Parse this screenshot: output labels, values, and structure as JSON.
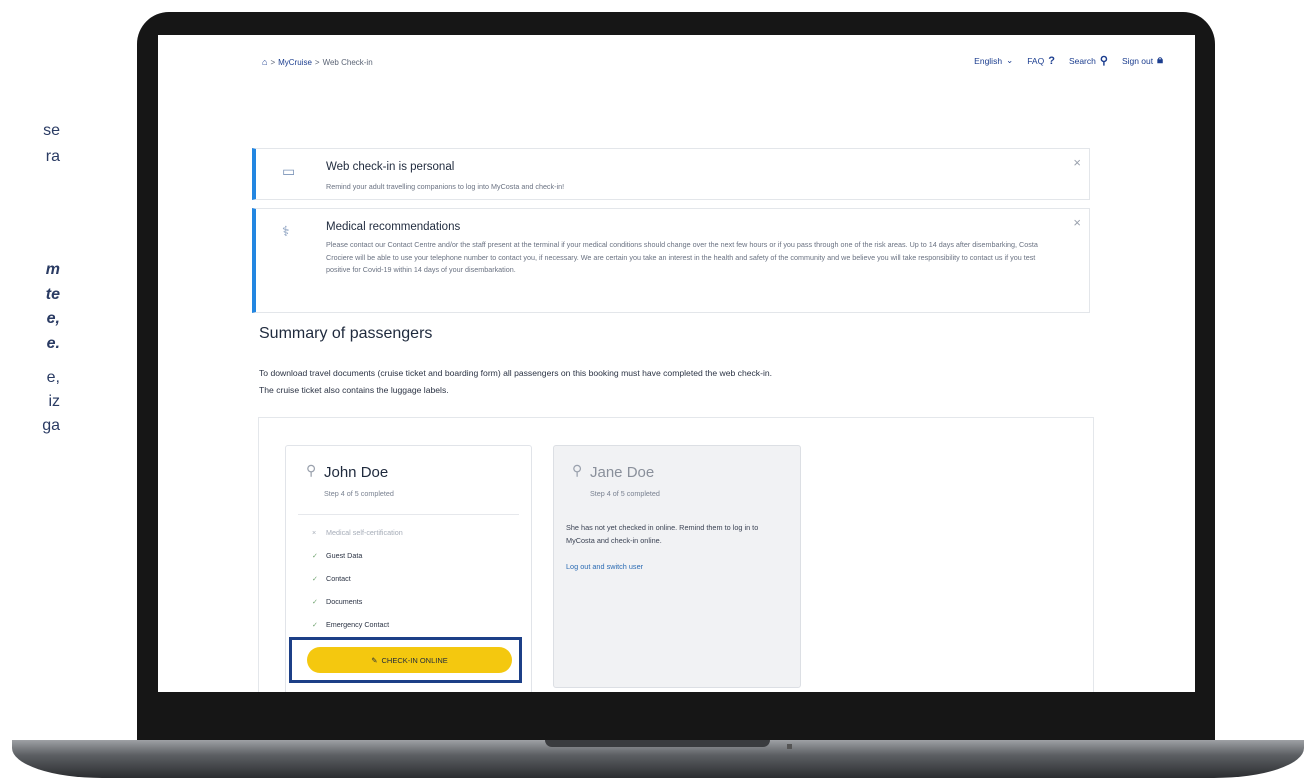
{
  "side_fragments": [
    {
      "text": "se",
      "style": "normal"
    },
    {
      "text": "ra",
      "style": "normal"
    },
    {
      "text": "m",
      "style": "bi"
    },
    {
      "text": "te",
      "style": "bi"
    },
    {
      "text": "e,",
      "style": "bi"
    },
    {
      "text": "e.",
      "style": "bi"
    },
    {
      "text": "e,",
      "style": "normal"
    },
    {
      "text": "iz",
      "style": "normal"
    },
    {
      "text": "ga",
      "style": "normal"
    }
  ],
  "breadcrumb": {
    "home_icon": "home-icon",
    "sep": ">",
    "mycruise": "MyCruise",
    "current": "Web Check-in"
  },
  "topnav": {
    "language": "English",
    "faq": "FAQ",
    "search": "Search",
    "signout": "Sign out"
  },
  "alerts": [
    {
      "title": "Web check-in is personal",
      "body": "Remind your adult travelling companions to log into MyCosta and check-in!"
    },
    {
      "title": "Medical recommendations",
      "body": "Please contact our Contact Centre and/or the staff present at the terminal if your medical conditions should change over the next few hours or if you pass through one of the risk areas. Up to 14 days after disembarking, Costa Crociere will be able to use your telephone number to contact you, if necessary. We are certain you take an interest in the health and safety of the community and we believe you will take responsibility to contact us if you test positive for Covid-19 within 14 days of your disembarkation."
    }
  ],
  "summary": {
    "title": "Summary of passengers",
    "line1": "To download travel documents (cruise ticket and boarding form) all passengers on this booking must have completed the web check-in.",
    "line2": "The cruise ticket also contains the luggage labels."
  },
  "passengers": [
    {
      "name": "John Doe",
      "step": "Step 4 of 5 completed",
      "steps": [
        {
          "label": "Medical self-certification",
          "done": false
        },
        {
          "label": "Guest Data",
          "done": true
        },
        {
          "label": "Contact",
          "done": true
        },
        {
          "label": "Documents",
          "done": true
        },
        {
          "label": "Emergency Contact",
          "done": true
        }
      ],
      "button": "Check-in online"
    },
    {
      "name": "Jane Doe",
      "step": "Step 4 of 5 completed",
      "message": "She has not yet checked in online. Remind them to log in to MyCosta and check-in online.",
      "link": "Log out and switch user"
    }
  ],
  "colors": {
    "accent_blue": "#2386e1",
    "button_yellow": "#f4c80f",
    "highlight_frame": "#1c3f87",
    "brand_navy": "#1b3d8f"
  }
}
